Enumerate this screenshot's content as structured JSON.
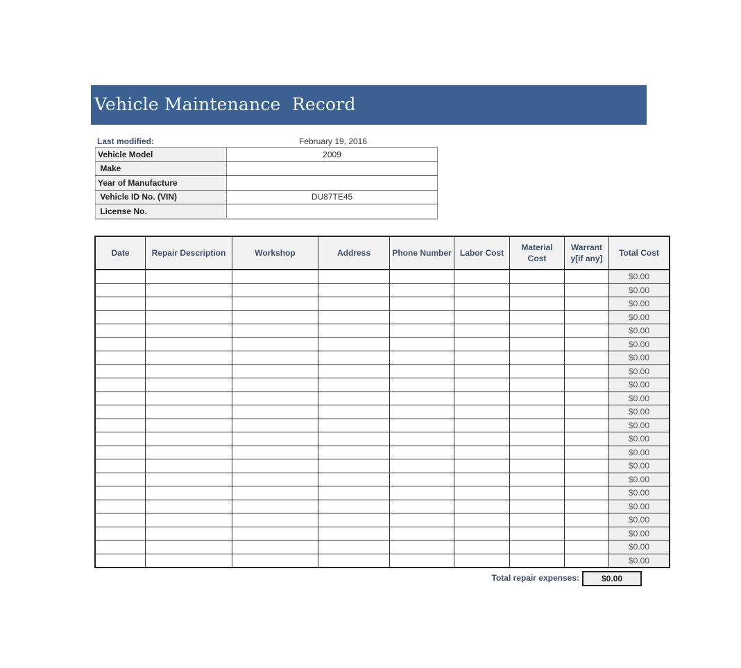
{
  "title": "Vehicle Maintenance  Record",
  "last_modified": {
    "label": "Last modified:",
    "value": "February 19, 2016"
  },
  "vehicle_info": [
    {
      "label": "Vehicle Model",
      "value": "2009"
    },
    {
      "label": " Make",
      "value": ""
    },
    {
      "label": "Year of Manufacture",
      "value": ""
    },
    {
      "label": " Vehicle ID No. (VIN)",
      "value": "DU87TE45"
    },
    {
      "label": " License No.",
      "value": ""
    }
  ],
  "log": {
    "columns": [
      "Date",
      "Repair Description",
      "Workshop",
      "Address",
      "Phone Number",
      "Labor Cost",
      "Material Cost",
      "Warrant y[if any]",
      "Total Cost"
    ],
    "row_count": 22,
    "row_total_value": "$0.00"
  },
  "total": {
    "label": "Total repair expenses:",
    "value": "$0.00"
  },
  "colors": {
    "header_bar": "#3a6192",
    "label_text": "#3b4e6b"
  }
}
